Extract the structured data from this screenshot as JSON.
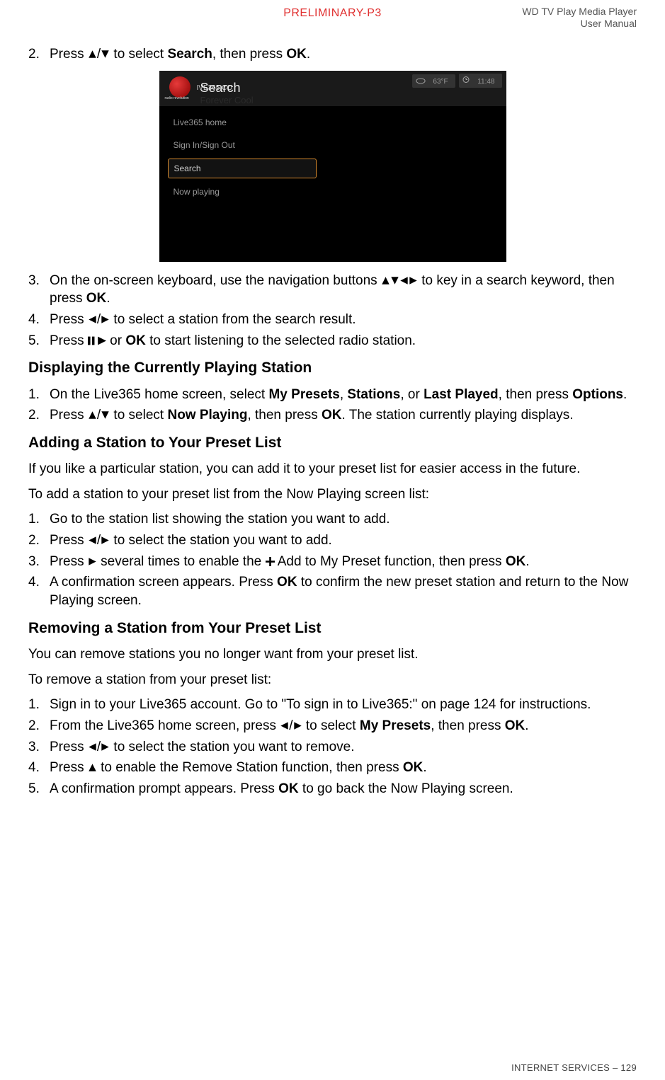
{
  "header": {
    "watermark": "PRELIMINARY-P3",
    "doc_title_line1": "WD TV Play Media Player",
    "doc_title_line2": "User Manual"
  },
  "step2": {
    "marker": "2.",
    "pre": "Press ",
    "mid": " to select ",
    "search": "Search",
    "mid2": ", then press ",
    "ok": "OK",
    "post": "."
  },
  "screenshot": {
    "brand_suffix": "IVE365.CO",
    "logo_sub": "radio revolution",
    "title": "Search",
    "subtitle_faded": "Forever Cool",
    "temp": "63°F",
    "time": "11:48",
    "menu": [
      "Live365 home",
      "Sign In/Sign Out",
      "Search",
      "Now playing"
    ]
  },
  "step3": {
    "marker": "3.",
    "pre": "On the on-screen keyboard, use the navigation buttons ",
    "mid": " to key in a search keyword, then press ",
    "ok": "OK",
    "post": "."
  },
  "step4": {
    "marker": "4.",
    "pre": "Press ",
    "post": " to select a station from the search result."
  },
  "step5": {
    "marker": "5.",
    "pre": "Press ",
    "mid": " or ",
    "ok": "OK",
    "post": " to start listening to the selected radio station."
  },
  "sectionA": "Displaying the Currently Playing Station",
  "secA_step1": {
    "marker": "1.",
    "pre": "On the Live365 home screen, select ",
    "b1": "My Presets",
    "sep1": ", ",
    "b2": "Stations",
    "sep2": ", or ",
    "b3": "Last Played",
    "mid": ", then press ",
    "b4": "Options",
    "post": "."
  },
  "secA_step2": {
    "marker": "2.",
    "pre": "Press ",
    "mid": " to select ",
    "b1": "Now Playing",
    "mid2": ", then press ",
    "ok": "OK",
    "post": ". The station currently playing displays."
  },
  "sectionB": "Adding a Station to Your Preset List",
  "secB_intro": "If you like a particular station, you can add it to your preset list for easier access in the future.",
  "secB_intro2": "To add a station to your preset list from the Now Playing screen list:",
  "secB_step1": {
    "marker": "1.",
    "text": "Go to the station list showing the station you want to add."
  },
  "secB_step2": {
    "marker": "2.",
    "pre": "Press ",
    "post": " to select the station you want to add."
  },
  "secB_step3": {
    "marker": "3.",
    "pre": "Press ",
    "mid": " several times to enable the ",
    "mid2": " Add to My Preset function, then press ",
    "ok": "OK",
    "post": "."
  },
  "secB_step4": {
    "marker": "4.",
    "pre": "A confirmation screen appears. Press ",
    "ok": "OK",
    "post": " to confirm the new preset station and return to the Now Playing screen."
  },
  "sectionC": "Removing a Station from Your Preset List",
  "secC_intro": "You can remove stations you no longer want from your preset list.",
  "secC_intro2": "To remove a station from your preset list:",
  "secC_step1": {
    "marker": "1.",
    "text": "Sign in to your Live365 account. Go to \"To sign in to Live365:\" on page 124 for instructions."
  },
  "secC_step2": {
    "marker": "2.",
    "pre": "From the Live365 home screen, press ",
    "mid": " to select ",
    "b1": "My Presets",
    "mid2": ", then press ",
    "ok": "OK",
    "post": "."
  },
  "secC_step3": {
    "marker": "3.",
    "pre": "Press ",
    "post": " to select the station you want to remove."
  },
  "secC_step4": {
    "marker": "4.",
    "pre": "Press ",
    "mid": " to enable the Remove Station function, then press ",
    "ok": "OK",
    "post": "."
  },
  "secC_step5": {
    "marker": "5.",
    "pre": "A confirmation prompt appears. Press ",
    "ok": "OK",
    "post": " to go back the Now Playing screen."
  },
  "footer": {
    "section": "INTERNET SERVICES – ",
    "page": "129"
  }
}
